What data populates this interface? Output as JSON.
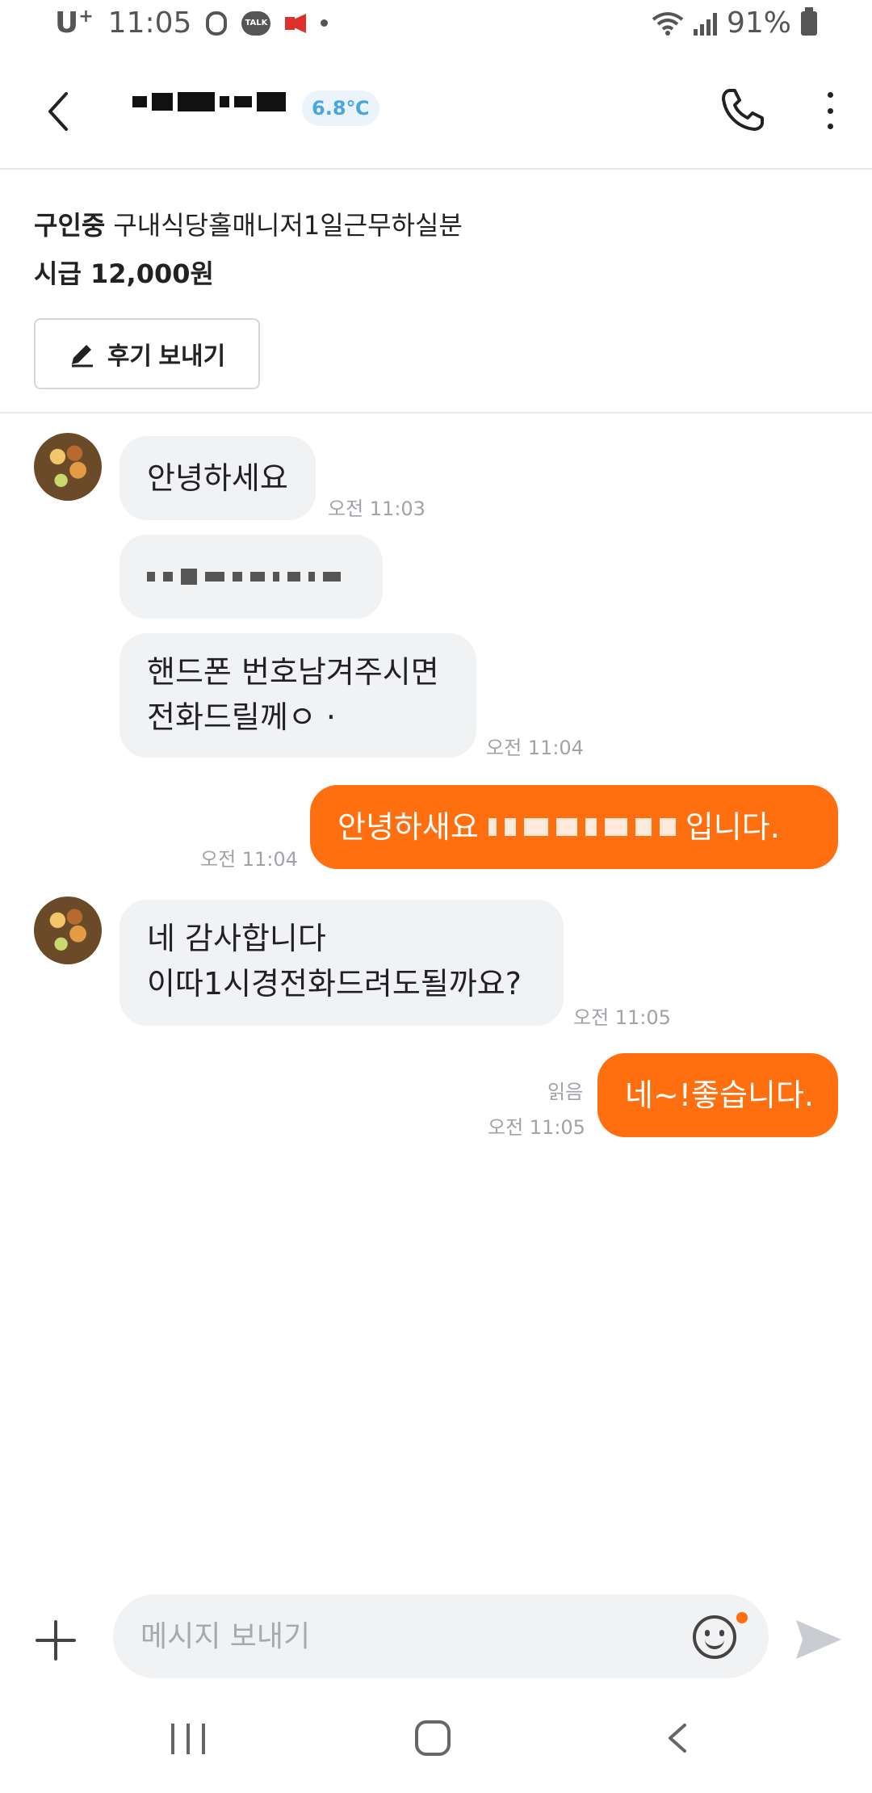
{
  "status_bar": {
    "carrier": "U",
    "carrier_sup": "+",
    "time": "11:05",
    "talk_label": "TALK",
    "battery": "91%"
  },
  "header": {
    "temperature": "6.8℃"
  },
  "job": {
    "status": "구인중",
    "title": "구내식당홀매니저1일근무하실분",
    "wage": "시급 12,000원",
    "review_button": "후기 보내기"
  },
  "messages": {
    "m1": {
      "text": "안녕하세요",
      "time": "오전 11:03"
    },
    "m3": {
      "line1": "핸드폰 번호남겨주시면",
      "line2": "전화드릴께ㅇ ·",
      "time": "오전 11:04"
    },
    "m4": {
      "prefix": "안녕하새요",
      "suffix": "입니다.",
      "time": "오전 11:04"
    },
    "m5": {
      "line1": "네 감사합니다",
      "line2": "이따1시경전화드려도될까요?",
      "time": "오전 11:05"
    },
    "m6": {
      "text": "네~!좋습니다.",
      "read": "읽음",
      "time": "오전 11:05"
    }
  },
  "input": {
    "placeholder": "메시지 보내기"
  },
  "colors": {
    "accent": "#ff6f0f",
    "incoming_bubble": "#f1f2f4",
    "temperature": "#4aa7dd"
  }
}
